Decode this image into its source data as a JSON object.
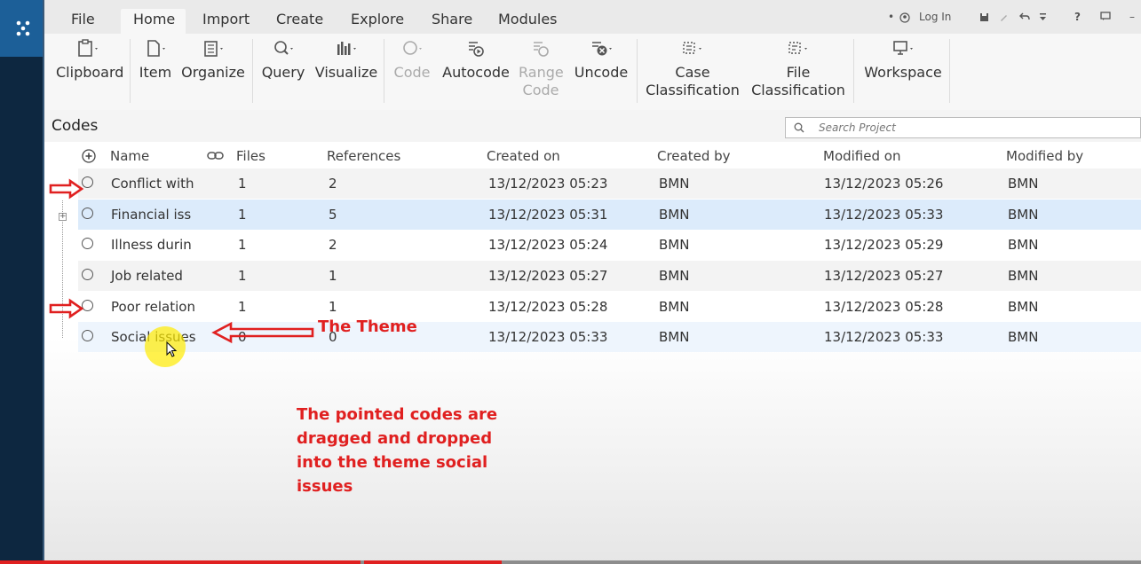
{
  "menu": {
    "tabs": [
      "File",
      "Home",
      "Import",
      "Create",
      "Explore",
      "Share",
      "Modules"
    ],
    "login": "Log In"
  },
  "ribbon": {
    "clipboard": "Clipboard",
    "item": "Item",
    "organize": "Organize",
    "query": "Query",
    "visualize": "Visualize",
    "code": "Code",
    "autocode": "Autocode",
    "range_code_1": "Range",
    "range_code_2": "Code",
    "uncode": "Uncode",
    "case_class_1": "Case",
    "case_class_2": "Classification",
    "file_class_1": "File",
    "file_class_2": "Classification",
    "workspace": "Workspace"
  },
  "codes": {
    "title": "Codes",
    "search_placeholder": "Search Project",
    "columns": {
      "name": "Name",
      "files": "Files",
      "references": "References",
      "created_on": "Created on",
      "created_by": "Created by",
      "modified_on": "Modified on",
      "modified_by": "Modified by"
    },
    "rows": [
      {
        "name": "Conflict with",
        "files": "1",
        "references": "2",
        "created_on": "13/12/2023 05:23",
        "created_by": "BMN",
        "modified_on": "13/12/2023 05:26",
        "modified_by": "BMN"
      },
      {
        "name": "Financial iss",
        "files": "1",
        "references": "5",
        "created_on": "13/12/2023 05:31",
        "created_by": "BMN",
        "modified_on": "13/12/2023 05:33",
        "modified_by": "BMN"
      },
      {
        "name": "Illness durin",
        "files": "1",
        "references": "2",
        "created_on": "13/12/2023 05:24",
        "created_by": "BMN",
        "modified_on": "13/12/2023 05:29",
        "modified_by": "BMN"
      },
      {
        "name": "Job related",
        "files": "1",
        "references": "1",
        "created_on": "13/12/2023 05:27",
        "created_by": "BMN",
        "modified_on": "13/12/2023 05:27",
        "modified_by": "BMN"
      },
      {
        "name": "Poor relation",
        "files": "1",
        "references": "1",
        "created_on": "13/12/2023 05:28",
        "created_by": "BMN",
        "modified_on": "13/12/2023 05:28",
        "modified_by": "BMN"
      },
      {
        "name": "Social issues",
        "files": "0",
        "references": "0",
        "created_on": "13/12/2023 05:33",
        "created_by": "BMN",
        "modified_on": "13/12/2023 05:33",
        "modified_by": "BMN"
      }
    ]
  },
  "annotations": {
    "theme": "The Theme",
    "note": "The pointed codes are dragged and dropped into the theme social issues",
    "color": "#e02020"
  },
  "video": {
    "progress_fraction": 0.44
  },
  "colors": {
    "rail": "#0d2740",
    "launcher": "#1c5f98",
    "selected_row": "#dcebfb"
  }
}
